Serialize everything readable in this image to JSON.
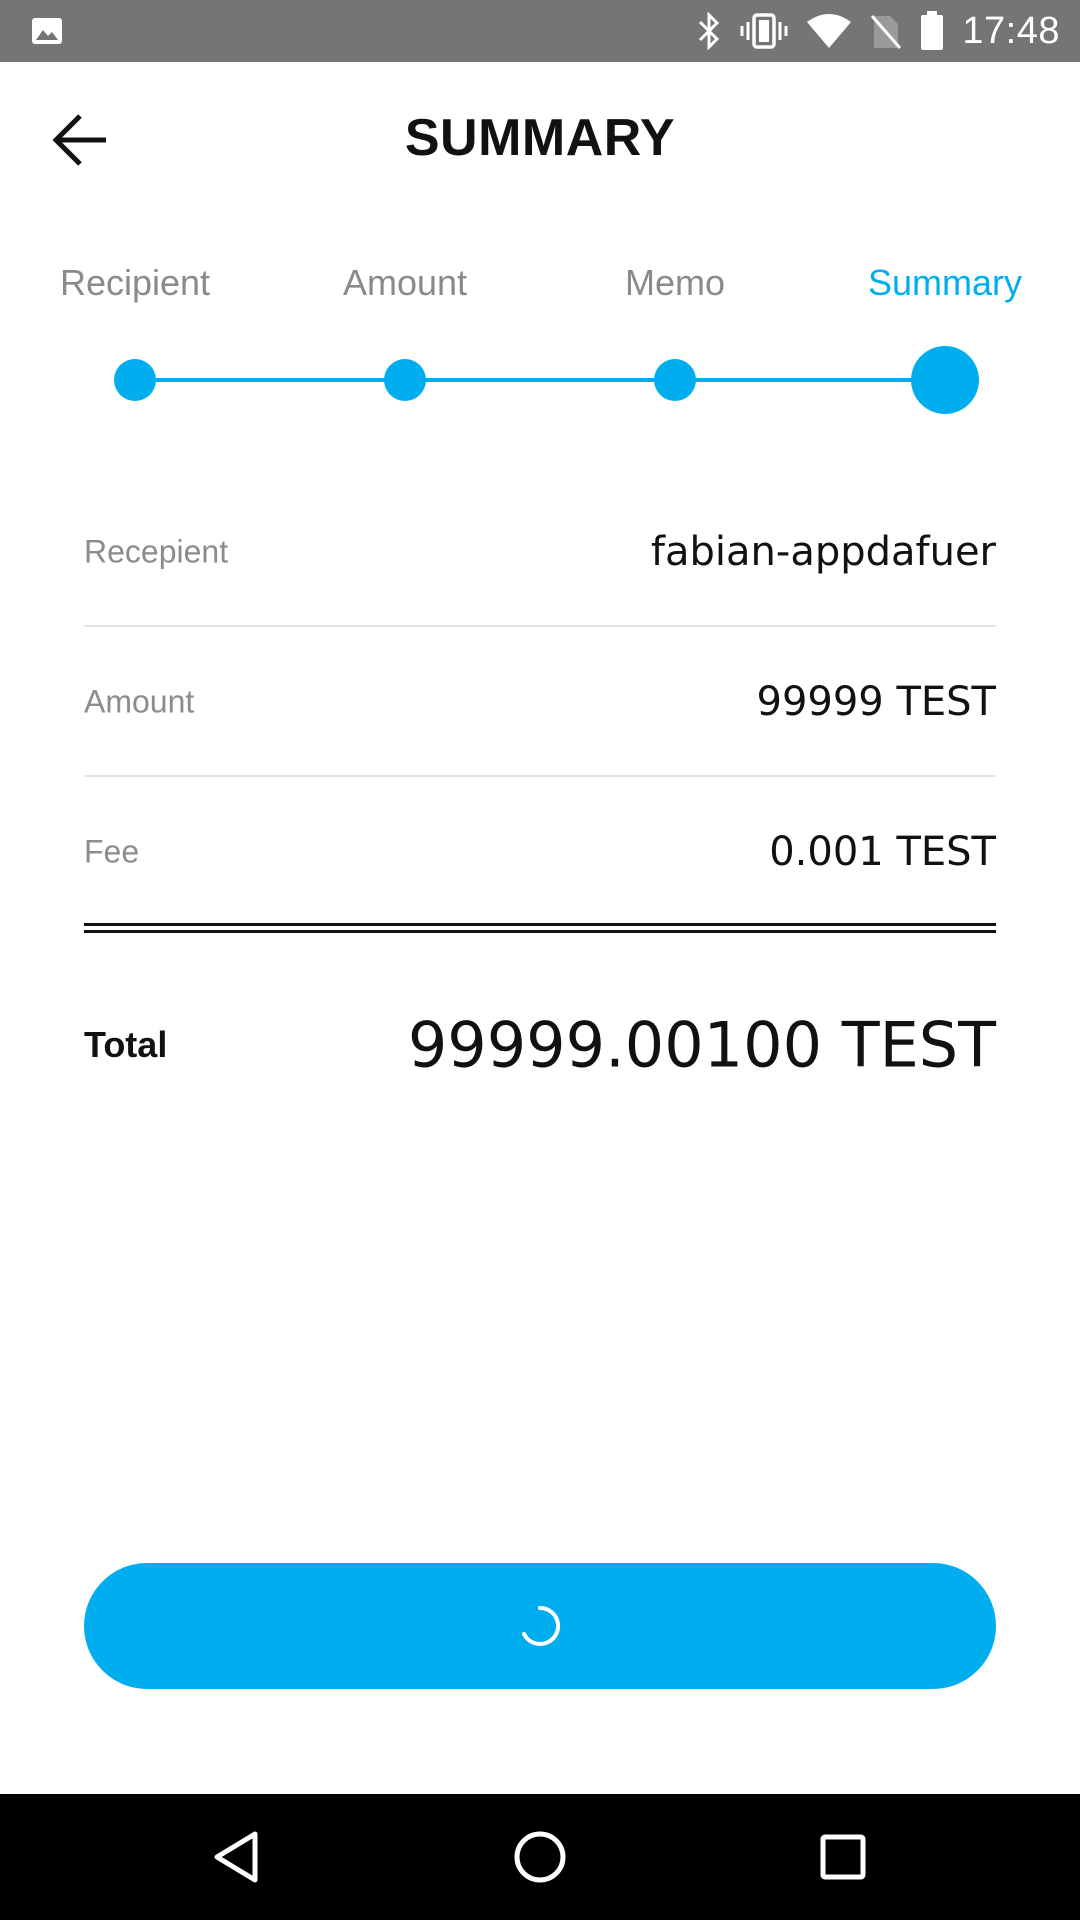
{
  "status_bar": {
    "time": "17:48",
    "icons": [
      "gallery-icon",
      "bluetooth-icon",
      "vibrate-icon",
      "wifi-icon",
      "no-sim-icon",
      "battery-icon"
    ]
  },
  "header": {
    "title": "SUMMARY",
    "back_icon": "arrow-left-icon"
  },
  "stepper": {
    "steps": [
      {
        "label": "Recipient",
        "active": false
      },
      {
        "label": "Amount",
        "active": false
      },
      {
        "label": "Memo",
        "active": false
      },
      {
        "label": "Summary",
        "active": true
      }
    ],
    "accent_color": "#00AEEF"
  },
  "summary": {
    "rows": [
      {
        "label": "Recepient",
        "value": "fabian-appdafuer"
      },
      {
        "label": "Amount",
        "value": "99999 TEST"
      },
      {
        "label": "Fee",
        "value": "0.001 TEST"
      }
    ],
    "total": {
      "label": "Total",
      "value": "99999.00100 TEST"
    }
  },
  "confirm_button": {
    "state": "loading",
    "icon": "loading-spinner-icon",
    "color": "#00AEEF"
  },
  "nav_bar": {
    "icons": [
      "back-triangle-icon",
      "home-circle-icon",
      "recents-square-icon"
    ]
  }
}
